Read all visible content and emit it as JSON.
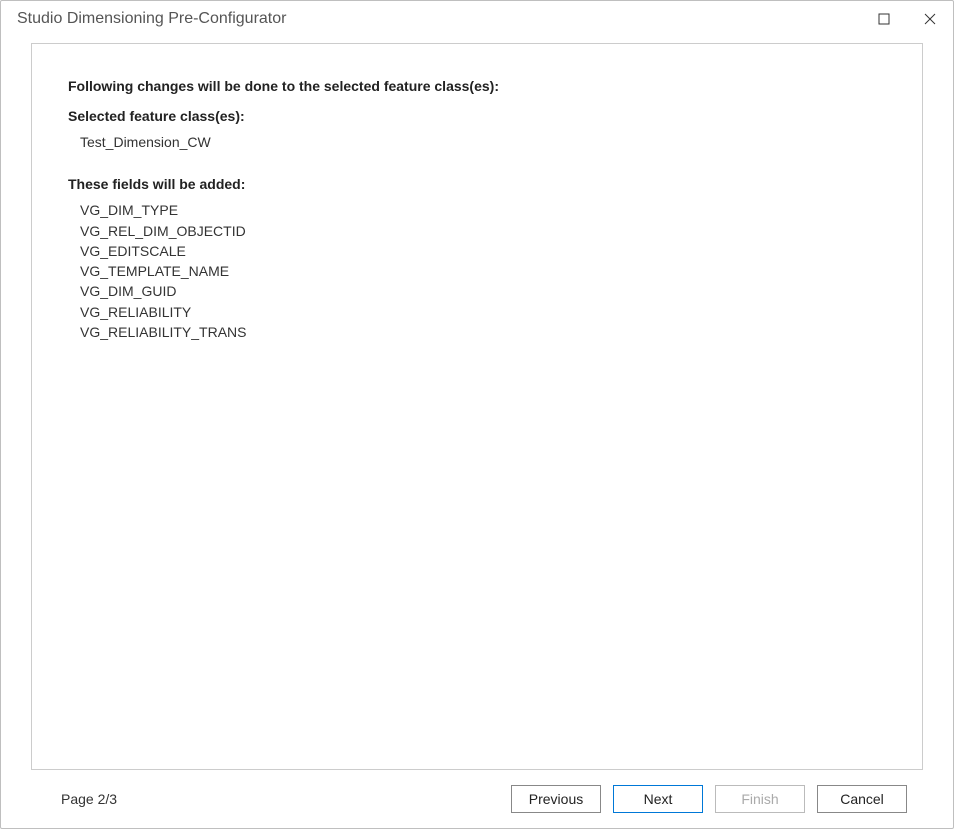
{
  "window": {
    "title": "Studio Dimensioning Pre-Configurator"
  },
  "content": {
    "intro_heading": "Following changes will be done to the selected feature class(es):",
    "selected_label": "Selected feature class(es):",
    "selected_items": [
      "Test_Dimension_CW"
    ],
    "fields_label": "These fields will be added:",
    "fields_items": [
      "VG_DIM_TYPE",
      "VG_REL_DIM_OBJECTID",
      "VG_EDITSCALE",
      "VG_TEMPLATE_NAME",
      "VG_DIM_GUID",
      "VG_RELIABILITY",
      "VG_RELIABILITY_TRANS"
    ]
  },
  "footer": {
    "page_indicator": "Page 2/3",
    "previous_label": "Previous",
    "next_label": "Next",
    "finish_label": "Finish",
    "cancel_label": "Cancel"
  }
}
